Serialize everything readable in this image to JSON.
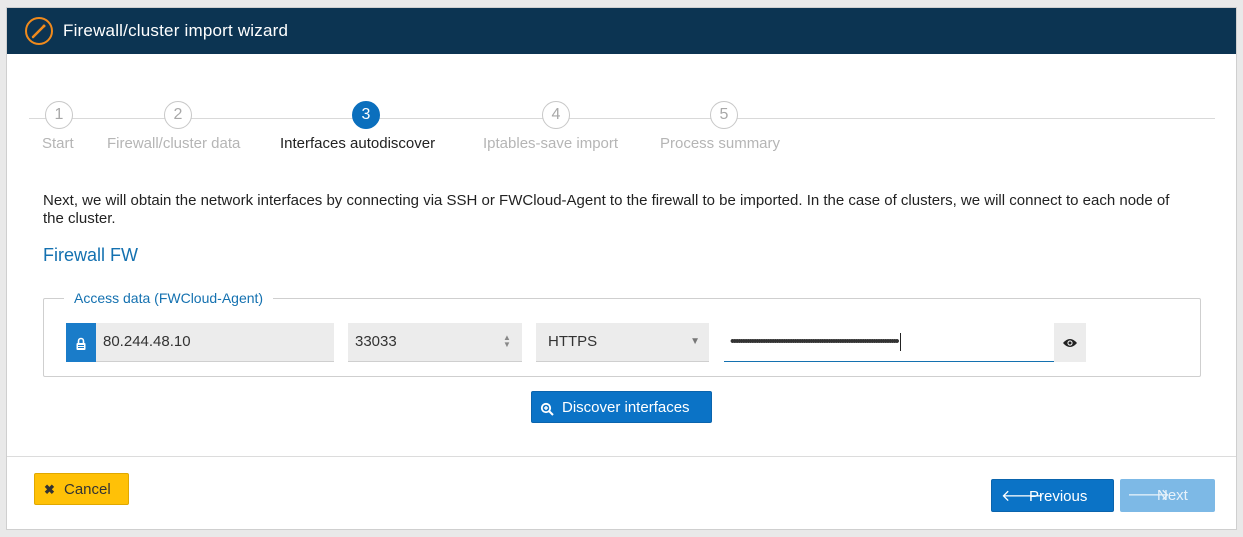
{
  "window": {
    "title": "Firewall/cluster import wizard",
    "icon": "wand-icon"
  },
  "steps": [
    {
      "num": "1",
      "label": "Start"
    },
    {
      "num": "2",
      "label": "Firewall/cluster data"
    },
    {
      "num": "3",
      "label": "Interfaces autodiscover"
    },
    {
      "num": "4",
      "label": "Iptables-save import"
    },
    {
      "num": "5",
      "label": "Process summary"
    }
  ],
  "active_step": 3,
  "intro": "Next, we will obtain the network interfaces by connecting via SSH or FWCloud-Agent to the firewall to be imported. In the case of clusters, we will connect to each node of the cluster.",
  "firewall_name": "Firewall FW",
  "access": {
    "legend": "Access data (FWCloud-Agent)",
    "host_icon": "network-lock-icon",
    "host": "80.244.48.10",
    "port": "33033",
    "protocol": "HTTPS",
    "password_mask": "••••••••••••••••••••••••••••••••••••••••••••••••••••••••••••••••••••••••••",
    "toggle_icon": "eye-icon"
  },
  "buttons": {
    "discover": "Discover interfaces",
    "cancel": "Cancel",
    "previous": "Previous",
    "next": "Next"
  },
  "colors": {
    "header": "#0c3452",
    "accent": "#0b73c6",
    "cancel": "#ffc107",
    "disabled": "#7db9e6"
  }
}
